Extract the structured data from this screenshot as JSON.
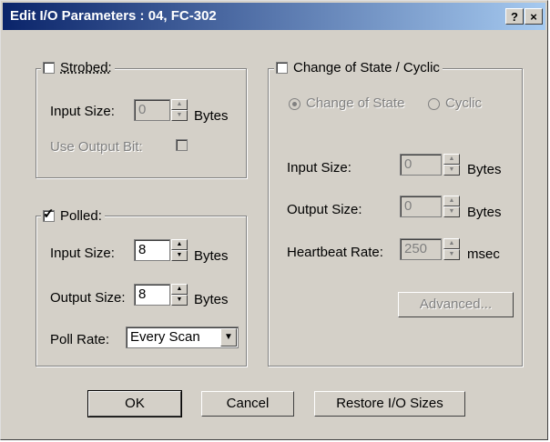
{
  "window": {
    "title": "Edit I/O Parameters : 04, FC-302",
    "help_button": "?",
    "close_button": "×"
  },
  "strobed": {
    "label": "Strobed:",
    "checked": false,
    "input_size_label": "Input Size:",
    "input_size_value": "0",
    "bytes_label": "Bytes",
    "use_output_bit_label": "Use Output Bit:"
  },
  "polled": {
    "label": "Polled:",
    "checked": true,
    "input_size_label": "Input Size:",
    "input_size_value": "8",
    "input_bytes_label": "Bytes",
    "output_size_label": "Output Size:",
    "output_size_value": "8",
    "output_bytes_label": "Bytes",
    "poll_rate_label": "Poll Rate:",
    "poll_rate_value": "Every Scan"
  },
  "cos": {
    "label": "Change of State / Cyclic",
    "checked": false,
    "radio_cos_label": "Change of State",
    "radio_cyclic_label": "Cyclic",
    "input_size_label": "Input Size:",
    "input_size_value": "0",
    "input_bytes_label": "Bytes",
    "output_size_label": "Output Size:",
    "output_size_value": "0",
    "output_bytes_label": "Bytes",
    "heartbeat_label": "Heartbeat Rate:",
    "heartbeat_value": "250",
    "heartbeat_unit": "msec",
    "advanced_label": "Advanced..."
  },
  "buttons": {
    "ok": "OK",
    "cancel": "Cancel",
    "restore": "Restore I/O Sizes"
  },
  "colors": {
    "titlebar_start": "#0a246a",
    "titlebar_end": "#a6caf0",
    "face": "#d4d0c8",
    "disabled_text": "#808080"
  }
}
